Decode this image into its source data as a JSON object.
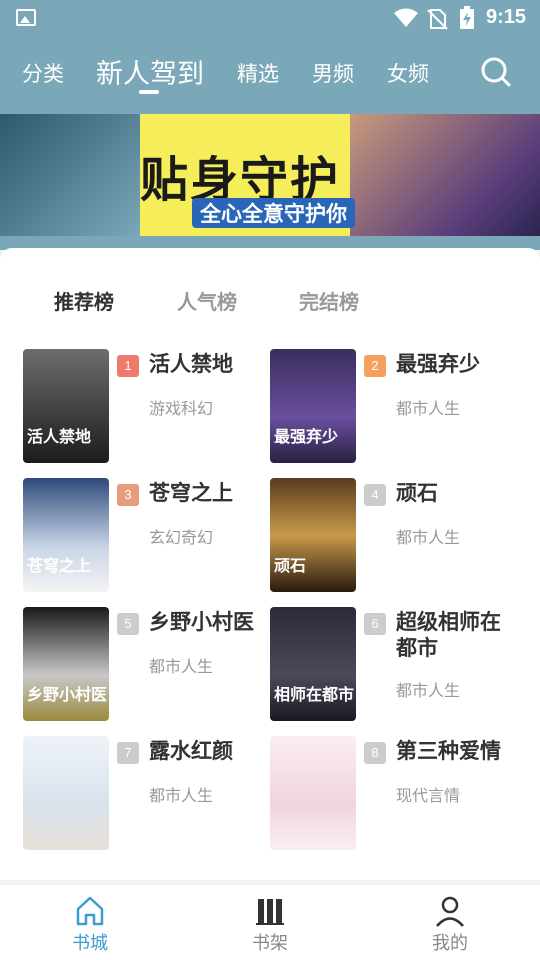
{
  "status": {
    "time": "9:15"
  },
  "tabs": [
    {
      "label": "分类"
    },
    {
      "label": "新人驾到"
    },
    {
      "label": "精选"
    },
    {
      "label": "男频"
    },
    {
      "label": "女频"
    }
  ],
  "banner": {
    "title": "贴身守护",
    "subtitle": "全心全意守护你"
  },
  "rank_tabs": [
    {
      "label": "推荐榜"
    },
    {
      "label": "人气榜"
    },
    {
      "label": "完结榜"
    }
  ],
  "books": [
    {
      "rank": "1",
      "title": "活人禁地",
      "genre": "游戏科幻",
      "cover_text": "活人禁地",
      "rank_color": "#f07a6a",
      "cover_bg": "linear-gradient(180deg,#6d6d6d,#1c1c1c)"
    },
    {
      "rank": "2",
      "title": "最强弃少",
      "genre": "都市人生",
      "cover_text": "最强弃少",
      "rank_color": "#f5a05e",
      "cover_bg": "linear-gradient(180deg,#3a2e5c,#6a4fa0 60%,#2a2040)"
    },
    {
      "rank": "3",
      "title": "苍穹之上",
      "genre": "玄幻奇幻",
      "cover_text": "苍穹之上",
      "rank_color": "#e89c7e",
      "cover_bg": "linear-gradient(180deg,#2f4a7c,#c8d4e6 60%,#f4f4f4)"
    },
    {
      "rank": "4",
      "title": "顽石",
      "genre": "都市人生",
      "cover_text": "顽石",
      "rank_color": "#cccccc",
      "cover_bg": "linear-gradient(180deg,#5a3a1e,#c89a4a 50%,#2a1a10)"
    },
    {
      "rank": "5",
      "title": "乡野小村医",
      "genre": "都市人生",
      "cover_text": "乡野小村医",
      "rank_color": "#cccccc",
      "cover_bg": "linear-gradient(180deg,#1a1a1a,#c8c8c8 60%,#9a8a3a)"
    },
    {
      "rank": "6",
      "title": "超级相师在都市",
      "genre": "都市人生",
      "cover_text": "相师在都市",
      "rank_color": "#cccccc",
      "cover_bg": "linear-gradient(180deg,#2a2a3a,#4a4a5a 60%,#1a1a24)"
    },
    {
      "rank": "7",
      "title": "露水红颜",
      "genre": "都市人生",
      "cover_text": "",
      "rank_color": "#cccccc",
      "cover_bg": "linear-gradient(180deg,#eef3f8,#d8e2ec 60%,#e8e0d8)"
    },
    {
      "rank": "8",
      "title": "第三种爱情",
      "genre": "现代言情",
      "cover_text": "",
      "rank_color": "#cccccc",
      "cover_bg": "linear-gradient(180deg,#fbeef2,#f1d4de 60%,#fbeef2)"
    }
  ],
  "bottom_nav": [
    {
      "label": "书城"
    },
    {
      "label": "书架"
    },
    {
      "label": "我的"
    }
  ]
}
